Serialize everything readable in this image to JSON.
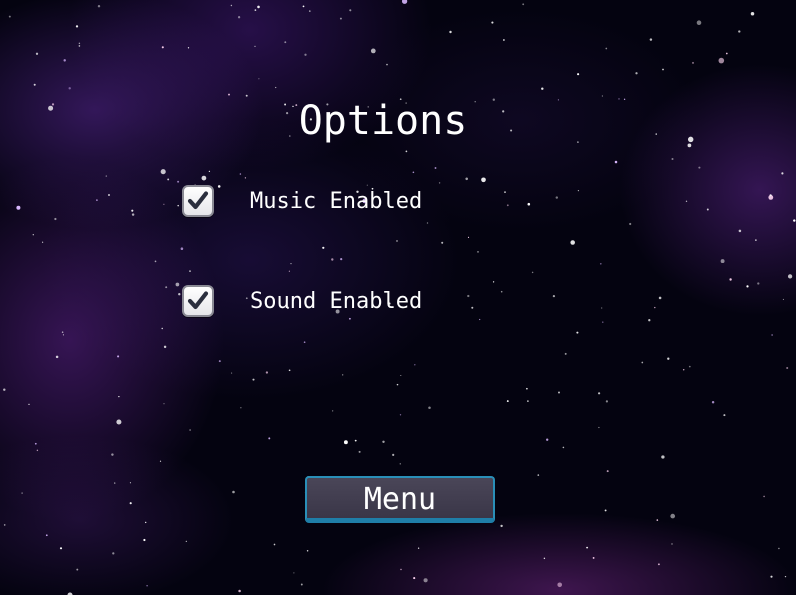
{
  "screen": {
    "title": "Options"
  },
  "options": [
    {
      "label": "Music Enabled",
      "checked": true,
      "icon": "checkmark-icon"
    },
    {
      "label": "Sound Enabled",
      "checked": true,
      "icon": "checkmark-icon"
    }
  ],
  "menu_button": {
    "label": "Menu"
  },
  "colors": {
    "background": "#040310",
    "nebula": "#5a2896",
    "button_border": "#2a8fb8",
    "button_fill": "#3e3a4e",
    "checkmark": "#2b2f3e"
  }
}
